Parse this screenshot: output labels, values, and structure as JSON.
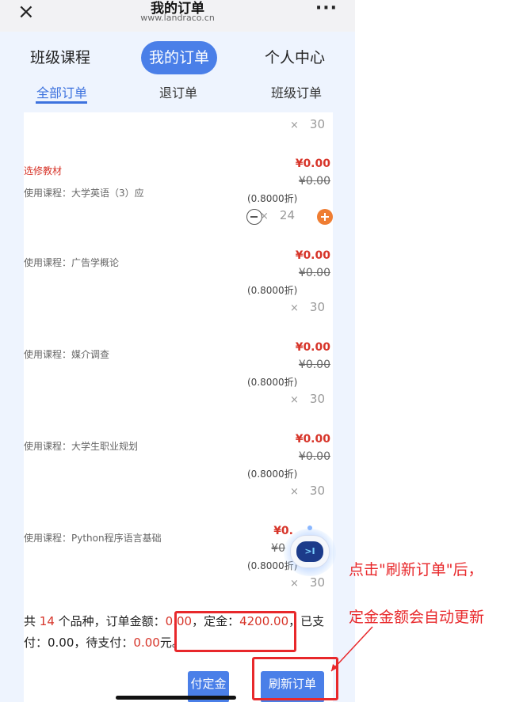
{
  "titlebar": {
    "close_icon": "×",
    "title": "我的订单",
    "subtitle": "www.landraco.cn",
    "more_icon": "···"
  },
  "nav": {
    "tabs": [
      {
        "label": "班级课程"
      },
      {
        "label": "我的订单",
        "active": true
      },
      {
        "label": "个人中心"
      }
    ]
  },
  "subtabs": [
    {
      "label": "全部订单",
      "active": true
    },
    {
      "label": "退订单"
    },
    {
      "label": "班级订单"
    }
  ],
  "top_partial": {
    "qty_x": "×",
    "qty": "30"
  },
  "items": [
    {
      "title": "选修教材",
      "course": "使用课程：大学英语（3）应",
      "price": "¥0.00",
      "original_price": "¥0.00",
      "discount": "(0.8000折)",
      "qty_x": "×",
      "qty": "24",
      "has_stepper": true
    },
    {
      "course": "使用课程：广告学概论",
      "price": "¥0.00",
      "original_price": "¥0.00",
      "discount": "(0.8000折)",
      "qty_x": "×",
      "qty": "30"
    },
    {
      "course": "使用课程：媒介调查",
      "price": "¥0.00",
      "original_price": "¥0.00",
      "discount": "(0.8000折)",
      "qty_x": "×",
      "qty": "30"
    },
    {
      "course": "使用课程：大学生职业规划",
      "price": "¥0.00",
      "original_price": "¥0.00",
      "discount": "(0.8000折)",
      "qty_x": "×",
      "qty": "30"
    },
    {
      "course": "使用课程：Python程序语言基础",
      "price": "¥0.",
      "original_price": "¥0",
      "discount": "(0.8000折)",
      "qty_x": "×",
      "qty": "30"
    }
  ],
  "summary": {
    "prefix": "共 ",
    "count": "14",
    "mid1": " 个品种，订单金额：",
    "order_amount": "0.00",
    "mid2": "，定金：",
    "deposit": "4200.00",
    "mid3": "，已支付：0.00，待支付：",
    "pending": "0.00",
    "suffix": "元。"
  },
  "buttons": {
    "pay_deposit": "付定金",
    "refresh_order": "刷新订单"
  },
  "robot": {
    "face": ">I"
  },
  "annotation": {
    "line1": "点击\"刷新订单\"后，",
    "line2": "定金金额会自动更新",
    "color": "#e8282b"
  },
  "colors": {
    "accent": "#4a7fe8",
    "price_red": "#d7352a",
    "plus_orange": "#ef7d32",
    "bg_blue": "#eef4fe"
  }
}
